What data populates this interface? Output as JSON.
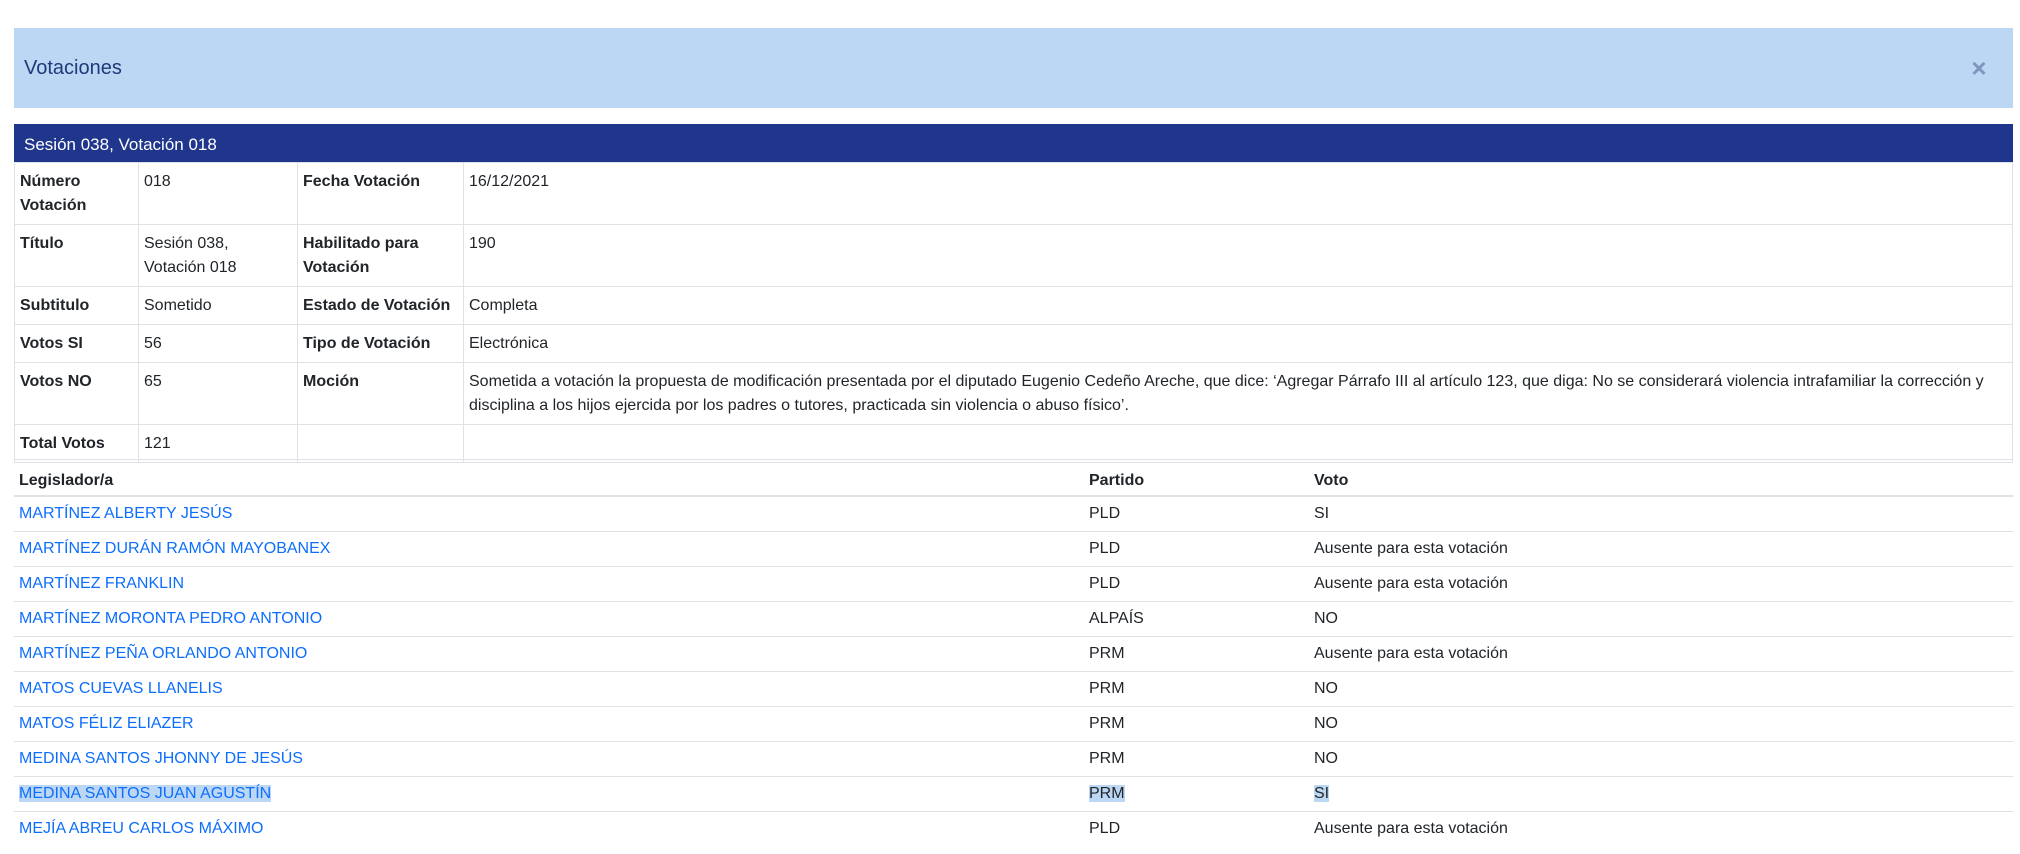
{
  "modal": {
    "title": "Votaciones",
    "close_label": "×"
  },
  "session": {
    "title": "Sesión 038, Votación 018"
  },
  "info": {
    "numero_label": "Número Votación",
    "numero_value": "018",
    "fecha_label": "Fecha Votación",
    "fecha_value": "16/12/2021",
    "titulo_label": "Título",
    "titulo_value": "Sesión 038, Votación 018",
    "habilitado_label": "Habilitado para Votación",
    "habilitado_value": "190",
    "subtitulo_label": "Subtitulo",
    "subtitulo_value": "Sometido",
    "estado_label": "Estado de Votación",
    "estado_value": "Completa",
    "votos_si_label": "Votos SI",
    "votos_si_value": "56",
    "tipo_label": "Tipo de Votación",
    "tipo_value": "Electrónica",
    "votos_no_label": "Votos NO",
    "votos_no_value": "65",
    "mocion_label": "Moción",
    "mocion_value": "Sometida a votación la propuesta de modificación presentada por el diputado Eugenio Cedeño Areche, que dice: ‘Agregar Párrafo III al artículo 123, que diga: No se considerará violencia intrafamiliar la corrección y disciplina a los hijos ejercida por los padres o tutores, practicada sin violencia o abuso físico’.",
    "total_label": "Total Votos",
    "total_value": "121"
  },
  "votes": {
    "headers": [
      "Legislador/a",
      "Partido",
      "Voto"
    ],
    "rows": [
      {
        "name": "MARTÍNEZ ALBERTY JESÚS",
        "party": "PLD",
        "vote": "SI"
      },
      {
        "name": "MARTÍNEZ DURÁN RAMÓN MAYOBANEX",
        "party": "PLD",
        "vote": "Ausente para esta votación"
      },
      {
        "name": "MARTÍNEZ FRANKLIN",
        "party": "PLD",
        "vote": "Ausente para esta votación"
      },
      {
        "name": "MARTÍNEZ MORONTA PEDRO ANTONIO",
        "party": "ALPAÍS",
        "vote": "NO"
      },
      {
        "name": "MARTÍNEZ PEÑA ORLANDO ANTONIO",
        "party": "PRM",
        "vote": "Ausente para esta votación"
      },
      {
        "name": "MATOS CUEVAS LLANELIS",
        "party": "PRM",
        "vote": "NO"
      },
      {
        "name": "MATOS FÉLIZ ELIAZER",
        "party": "PRM",
        "vote": "NO"
      },
      {
        "name": "MEDINA SANTOS JHONNY DE JESÚS",
        "party": "PRM",
        "vote": "NO"
      },
      {
        "name": "MEDINA SANTOS JUAN AGUSTÍN",
        "party": "PRM",
        "vote": "SI"
      },
      {
        "name": "MEJÍA ABREU CARLOS MÁXIMO",
        "party": "PLD",
        "vote": "Ausente para esta votación"
      }
    ]
  },
  "colors": {
    "header_bg": "#bcd7f3",
    "session_bg": "#1f368c",
    "link": "#0d6efd",
    "selection": "#bcd7f3"
  }
}
